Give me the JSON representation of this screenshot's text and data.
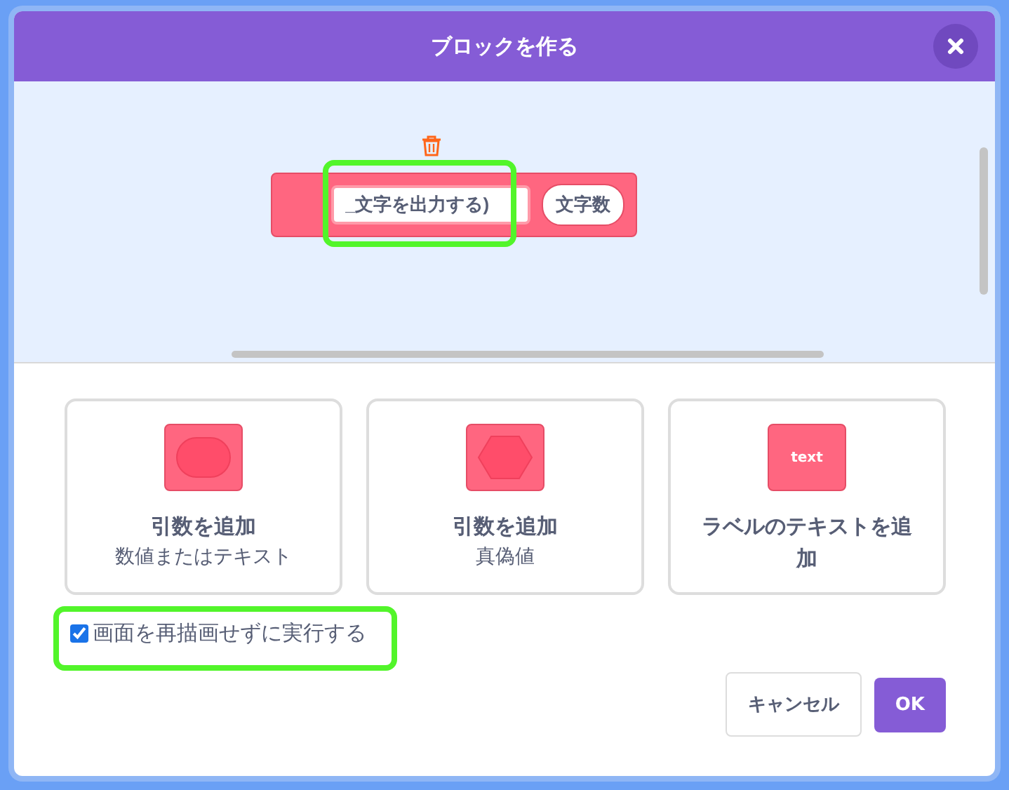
{
  "dialog": {
    "title": "ブロックを作る"
  },
  "block": {
    "name_field": "_文字を出力する)",
    "argument": "文字数"
  },
  "options": [
    {
      "kind": "number",
      "title": "引数を追加",
      "subtitle": "数値またはテキスト"
    },
    {
      "kind": "boolean",
      "title": "引数を追加",
      "subtitle": "真偽値"
    },
    {
      "kind": "label",
      "icon_text": "text",
      "title": "ラベルのテキストを追加"
    }
  ],
  "run_without_refresh": {
    "label": "画面を再描画せずに実行する",
    "checked": true
  },
  "buttons": [
    {
      "label": "キャンセル",
      "kind": "secondary"
    },
    {
      "label": "OK",
      "kind": "primary"
    }
  ]
}
